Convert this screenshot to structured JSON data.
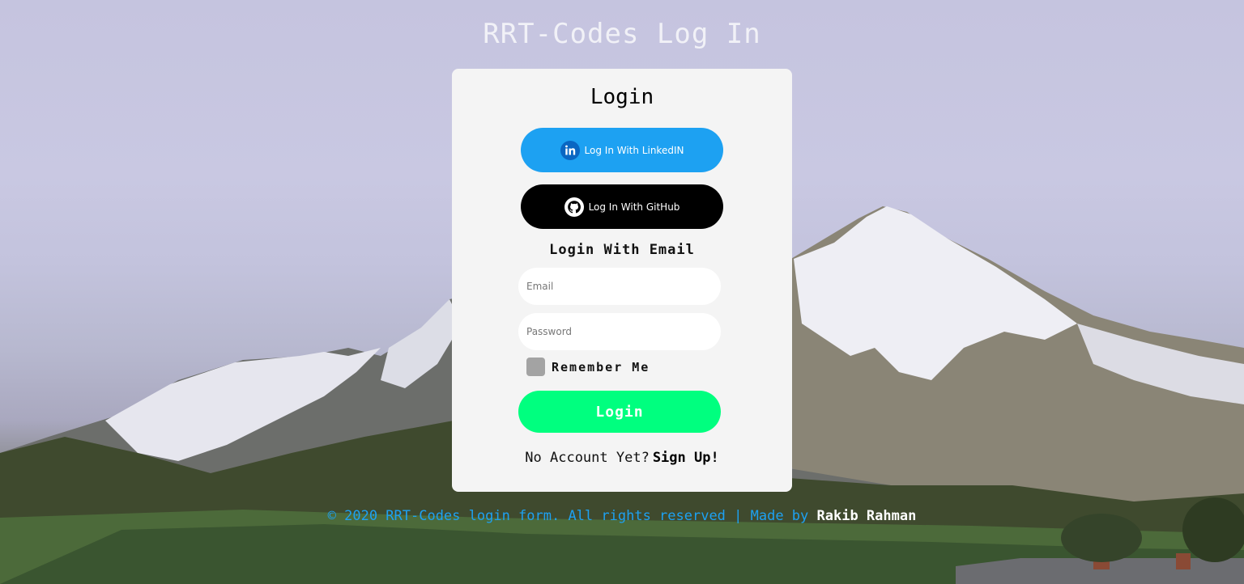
{
  "page": {
    "title": "RRT-Codes Log In"
  },
  "card": {
    "title": "Login",
    "linkedin_label": "Log In With LinkedIN",
    "github_label": "Log In With GitHub",
    "email_heading": "Login With Email",
    "email_placeholder": "Email",
    "password_placeholder": "Password",
    "remember_label": "Remember Me",
    "login_label": "Login",
    "no_account_text": "No Account Yet?",
    "signup_label": "Sign Up!"
  },
  "footer": {
    "text": "© 2020 RRT-Codes login form. All rights reserved | Made by",
    "author": "Rakib Rahman"
  },
  "colors": {
    "linkedin": "#1da1f2",
    "github": "#000000",
    "login": "#00ff7f",
    "card_bg": "#f4f4f4",
    "footer_text": "#1da1f2"
  },
  "icons": {
    "linkedin": "linkedin-icon",
    "github": "github-icon"
  }
}
